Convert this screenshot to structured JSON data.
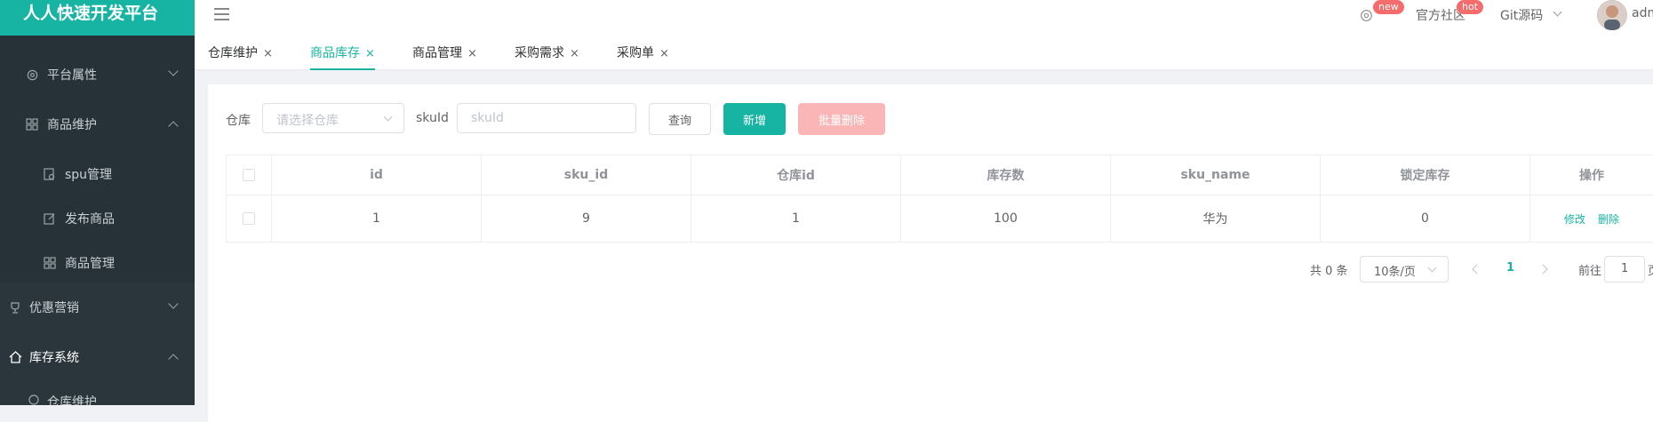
{
  "app": {
    "title": "人人快速开发平台"
  },
  "sidebar": {
    "items": [
      {
        "label": "平台属性"
      },
      {
        "label": "商品维护"
      },
      {
        "label": "spu管理"
      },
      {
        "label": "发布商品"
      },
      {
        "label": "商品管理"
      },
      {
        "label": "优惠营销"
      },
      {
        "label": "库存系统"
      },
      {
        "label": "仓库维护"
      }
    ]
  },
  "topbar": {
    "badge_new": "new",
    "community": "官方社区",
    "badge_hot": "hot",
    "git": "Git源码",
    "user": "adm"
  },
  "tabs": [
    {
      "label": "仓库维护"
    },
    {
      "label": "商品库存"
    },
    {
      "label": "商品管理"
    },
    {
      "label": "采购需求"
    },
    {
      "label": "采购单"
    }
  ],
  "tab_close": "×",
  "filter": {
    "warehouse_label": "仓库",
    "warehouse_placeholder": "请选择仓库",
    "skuid_label": "skuId",
    "skuid_placeholder": "skuId",
    "query": "查询",
    "add": "新增",
    "batch_delete": "批量删除"
  },
  "table": {
    "headers": [
      "id",
      "sku_id",
      "仓库id",
      "库存数",
      "sku_name",
      "锁定库存",
      "操作"
    ],
    "rows": [
      {
        "id": "1",
        "sku_id": "9",
        "ware_id": "1",
        "stock": "100",
        "sku_name": "华为",
        "locked": "0",
        "edit": "修改",
        "delete": "删除"
      }
    ]
  },
  "pagination": {
    "total": "共 0 条",
    "page_size": "10条/页",
    "current": "1",
    "goto_label": "前往",
    "goto_value": "1",
    "page_suffix": "页"
  },
  "colors": {
    "accent": "#17b3a3",
    "sidebar": "#263238",
    "danger_disabled": "#fab6b6"
  }
}
